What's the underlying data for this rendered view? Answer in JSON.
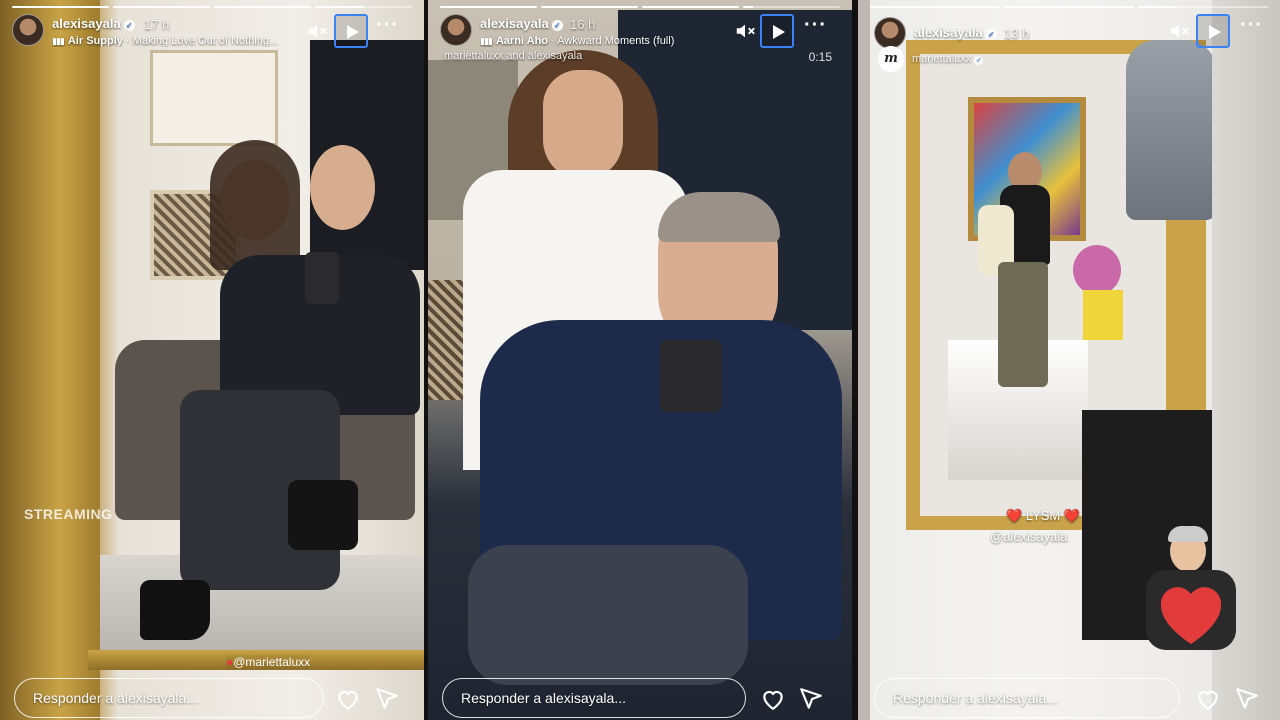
{
  "stories": [
    {
      "username": "alexisayala",
      "time": "17 h",
      "music_artist": "Air Supply",
      "music_separator": "·",
      "music_title": "Making Love Out of Nothing...",
      "overlay_streaming": "STREAMING",
      "mention": "@mariettaluxx",
      "reply_placeholder": "Responder a alexisayala...",
      "progress": [
        1.0,
        1.0,
        1.0,
        0.5
      ]
    },
    {
      "username": "alexisayala",
      "time": "16 h",
      "music_artist": "Aarni Aho",
      "music_separator": "·",
      "music_title": "Awkward Moments (full)",
      "collab": "mariettaluxx and alexisayala",
      "duration": "0:15",
      "reply_placeholder": "Responder a alexisayala...",
      "progress": [
        1.0,
        1.0,
        1.0,
        0.1
      ]
    },
    {
      "username": "alexisayala",
      "time": "13 h",
      "reposted_from": "mariettaluxx",
      "lysm_text": "❤️ LYSM ❤️",
      "sticker_mention": "@alexisayala",
      "reply_placeholder": "Responder a alexisayala...",
      "progress": [
        1.0,
        1.0,
        0.3
      ]
    }
  ],
  "icons": {
    "mute": "speaker-muted-icon",
    "play": "play-icon",
    "more": "more-options-icon",
    "heart": "heart-icon",
    "send": "send-icon",
    "verified": "verified-badge-icon"
  },
  "colors": {
    "play_highlight": "#3b82f6",
    "heart_sticker": "#e23b3b"
  }
}
